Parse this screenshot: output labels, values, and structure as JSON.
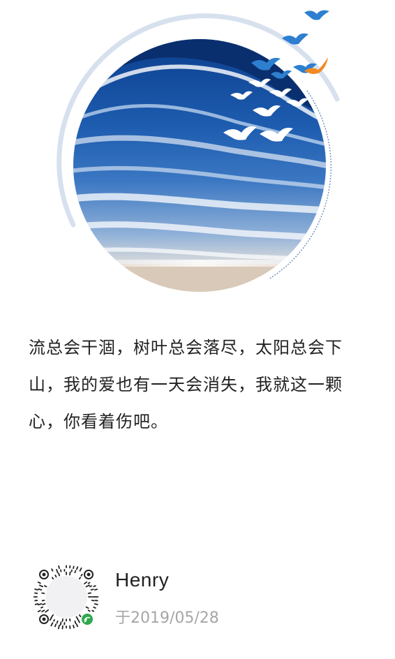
{
  "quote": {
    "text": "流总会干涸，树叶总会落尽，太阳总会下山，我的爱也有一天会消失，我就这一颗心，你看着伤吧。"
  },
  "author": {
    "name": "Henry",
    "date": "于2019/05/28"
  },
  "colors": {
    "ring": "#d7e1ee",
    "dashed_ring": "#5a7fb5",
    "qr_badge": "#2fa84f",
    "text_primary": "#222222",
    "text_secondary": "#a6a6a6"
  }
}
